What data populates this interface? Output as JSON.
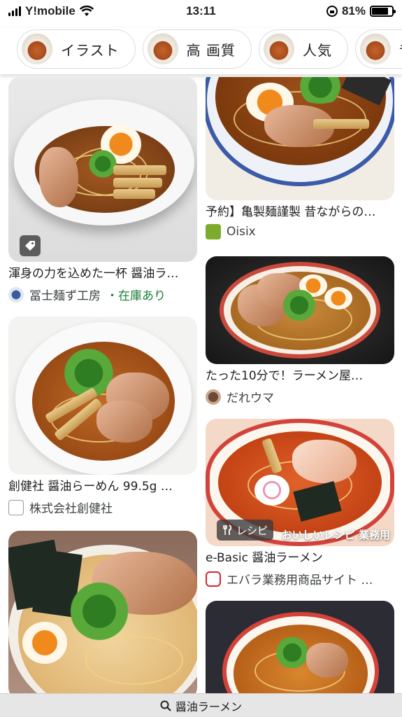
{
  "status": {
    "carrier": "Y!mobile",
    "time": "13:11",
    "battery_text": "81%",
    "battery_level": 0.81
  },
  "chips": [
    {
      "label": "イラスト"
    },
    {
      "label": "高 画質"
    },
    {
      "label": "人気"
    },
    {
      "label": "昔"
    }
  ],
  "results": {
    "left": [
      {
        "title": "渾身の力を込めた一杯 醤油ラ…",
        "source": "冨士麺ず工房",
        "stock": "・在庫あり",
        "badge_icon": "tag-icon"
      },
      {
        "title": "創健社 醤油らーめん 99.5g …",
        "source": "株式会社創健社"
      },
      {
        "title": "",
        "source": ""
      }
    ],
    "right": [
      {
        "title": "予約】亀製麺謹製 昔ながらの…",
        "source": "Oisix"
      },
      {
        "title": "たった10分で！ラーメン屋…",
        "source": "だれウマ"
      },
      {
        "title": "e-Basic 醤油ラーメン",
        "source": "エバラ業務用商品サイト …",
        "badge_label": "レシピ",
        "overlay_text": "おいしいレシピ 業務用"
      },
      {
        "title": "",
        "source": ""
      }
    ]
  },
  "search": {
    "query": "醤油ラーメン"
  },
  "colors": {
    "in_stock": "#188038",
    "chip_border": "#dadce0"
  }
}
